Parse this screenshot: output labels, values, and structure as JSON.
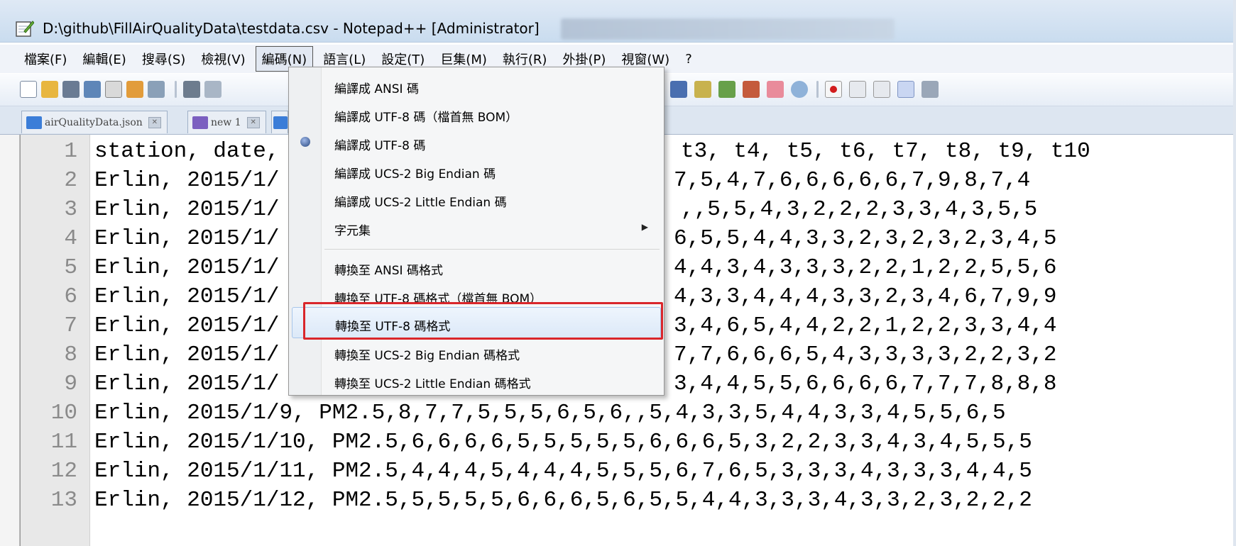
{
  "window": {
    "title": "D:\\github\\FillAirQualityData\\testdata.csv - Notepad++ [Administrator]"
  },
  "menubar": {
    "items": [
      "檔案(F)",
      "編輯(E)",
      "搜尋(S)",
      "檢視(V)",
      "編碼(N)",
      "語言(L)",
      "設定(T)",
      "巨集(M)",
      "執行(R)",
      "外掛(P)",
      "視窗(W)",
      "?"
    ],
    "active": "編碼(N)"
  },
  "tabs": [
    {
      "label": "airQualityData.json"
    },
    {
      "label": "new 1"
    }
  ],
  "encoding_menu": {
    "items": [
      {
        "label": "編譯成 ANSI 碼"
      },
      {
        "label": "編譯成 UTF-8 碼（檔首無 BOM）"
      },
      {
        "label": "編譯成 UTF-8 碼",
        "checked": true
      },
      {
        "label": "編譯成 UCS-2 Big Endian 碼"
      },
      {
        "label": "編譯成 UCS-2 Little Endian 碼"
      },
      {
        "label": "字元集",
        "submenu": true
      },
      {
        "label": "轉換至 ANSI 碼格式"
      },
      {
        "label": "轉換至 UTF-8 碼格式（檔首無 BOM）"
      },
      {
        "label": "轉換至 UTF-8 碼格式",
        "highlighted": true
      },
      {
        "label": "轉換至 UCS-2 Big Endian 碼格式"
      },
      {
        "label": "轉換至 UCS-2 Little Endian 碼格式"
      }
    ]
  },
  "editor": {
    "lines": [
      {
        "n": "1",
        "left": "station, date,",
        "right": "t3, t4, t5, t6, t7, t8, t9, t10"
      },
      {
        "n": "2",
        "left": "Erlin, 2015/1/",
        "right": "7,5,4,7,6,6,6,6,6,7,9,8,7,4"
      },
      {
        "n": "3",
        "left": "Erlin, 2015/1/",
        "right": ",,5,5,4,3,2,2,2,3,3,4,3,5,5"
      },
      {
        "n": "4",
        "left": "Erlin, 2015/1/",
        "right": "6,5,5,4,4,3,3,2,3,2,3,2,3,4,5"
      },
      {
        "n": "5",
        "left": "Erlin, 2015/1/",
        "right": "4,4,3,4,3,3,3,2,2,1,2,2,5,5,6"
      },
      {
        "n": "6",
        "left": "Erlin, 2015/1/",
        "right": "4,3,3,4,4,4,3,3,2,3,4,6,7,9,9"
      },
      {
        "n": "7",
        "left": "Erlin, 2015/1/",
        "right": "3,4,6,5,4,4,2,2,1,2,2,3,3,4,4"
      },
      {
        "n": "8",
        "left": "Erlin, 2015/1/",
        "right": "7,7,6,6,6,5,4,3,3,3,3,2,2,3,2"
      },
      {
        "n": "9",
        "left": "Erlin, 2015/1/",
        "right": "3,4,4,5,5,6,6,6,6,7,7,7,8,8,8"
      },
      {
        "n": "10",
        "full": "Erlin, 2015/1/9, PM2.5,8,7,7,5,5,5,6,5,6,,5,4,3,3,5,4,4,3,3,4,5,5,6,5"
      },
      {
        "n": "11",
        "full": "Erlin, 2015/1/10, PM2.5,6,6,6,6,5,5,5,5,5,6,6,6,5,3,2,2,3,3,4,3,4,5,5,5"
      },
      {
        "n": "12",
        "full": "Erlin, 2015/1/11, PM2.5,4,4,4,5,4,4,4,5,5,5,6,7,6,5,3,3,3,4,3,3,3,4,4,5"
      },
      {
        "n": "13",
        "full": "Erlin, 2015/1/12, PM2.5,5,5,5,5,6,6,6,5,6,5,5,4,4,3,3,3,4,3,3,2,3,2,2,2"
      }
    ]
  },
  "colors": {
    "highlight_box": "#d9262b",
    "line_number": "#8a8a8a"
  }
}
